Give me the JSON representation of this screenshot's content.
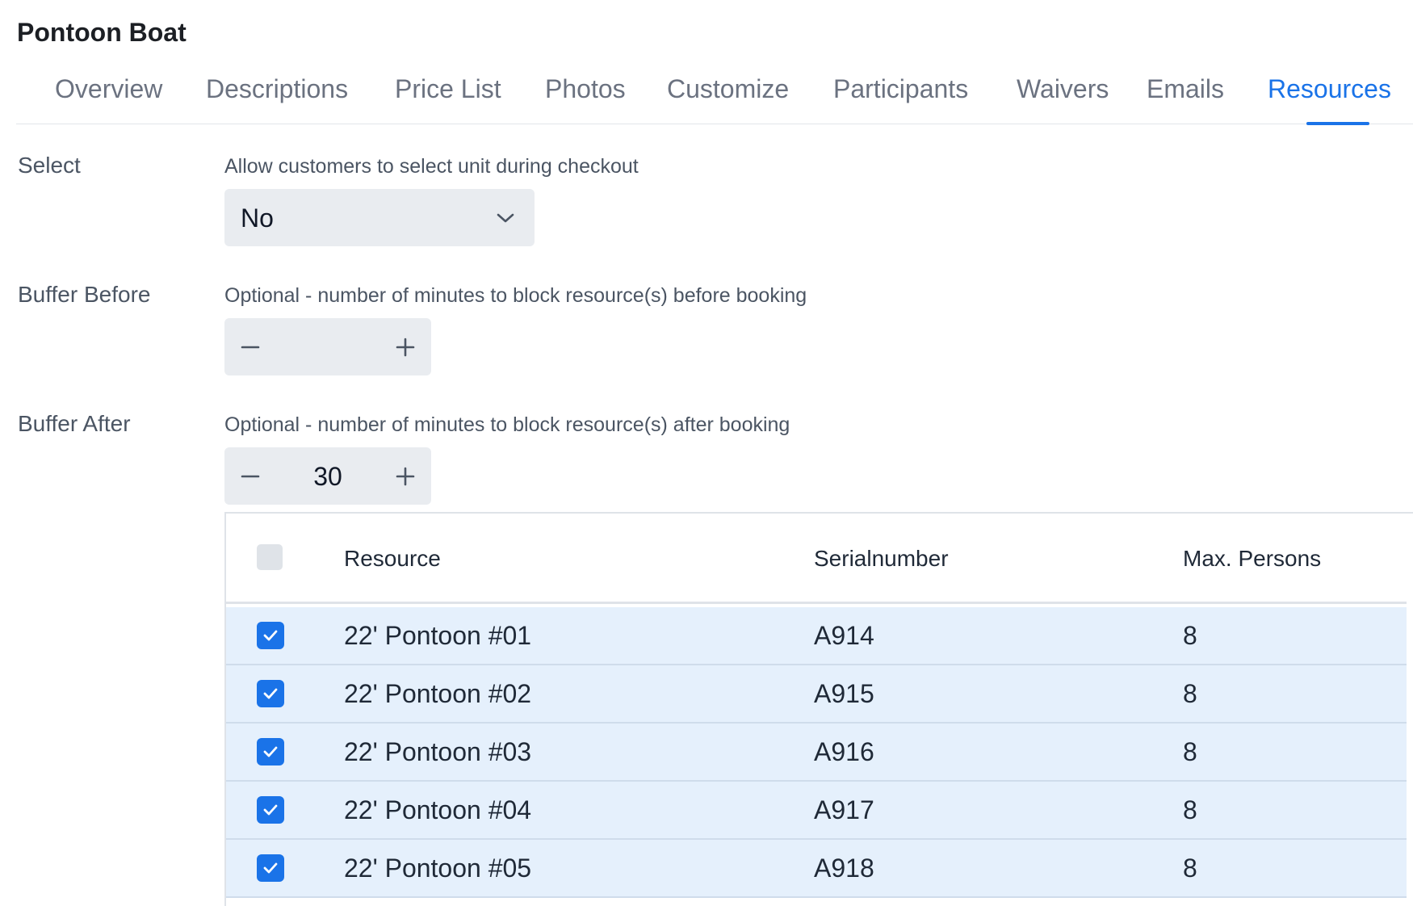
{
  "page": {
    "title": "Pontoon Boat"
  },
  "tabs": [
    {
      "label": "Overview",
      "active": false
    },
    {
      "label": "Descriptions",
      "active": false
    },
    {
      "label": "Price List",
      "active": false
    },
    {
      "label": "Photos",
      "active": false
    },
    {
      "label": "Customize",
      "active": false
    },
    {
      "label": "Participants",
      "active": false
    },
    {
      "label": "Waivers",
      "active": false
    },
    {
      "label": "Emails",
      "active": false
    },
    {
      "label": "Resources",
      "active": true
    }
  ],
  "settings": {
    "select": {
      "label": "Select",
      "help": "Allow customers to select unit during checkout",
      "value": "No"
    },
    "buffer_before": {
      "label": "Buffer Before",
      "help": "Optional - number of minutes to block resource(s) before booking",
      "value": ""
    },
    "buffer_after": {
      "label": "Buffer After",
      "help": "Optional - number of minutes to block resource(s) after booking",
      "value": "30"
    }
  },
  "table": {
    "header": {
      "resource": "Resource",
      "serial": "Serialnumber",
      "max": "Max. Persons",
      "select_all_checked": false
    },
    "rows": [
      {
        "resource": "22' Pontoon #01",
        "serial": "A914",
        "max": "8",
        "checked": true
      },
      {
        "resource": "22' Pontoon #02",
        "serial": "A915",
        "max": "8",
        "checked": true
      },
      {
        "resource": "22' Pontoon #03",
        "serial": "A916",
        "max": "8",
        "checked": true
      },
      {
        "resource": "22' Pontoon #04",
        "serial": "A917",
        "max": "8",
        "checked": true
      },
      {
        "resource": "22' Pontoon #05",
        "serial": "A918",
        "max": "8",
        "checked": true
      }
    ]
  },
  "colors": {
    "accent": "#1a73e8",
    "row_selected_bg": "#e5f0fc",
    "control_bg": "#e9ecf0"
  },
  "icons": {
    "select_arrow": "chevron-down-icon",
    "decrement": "minus-icon",
    "increment": "plus-icon",
    "checked": "checkmark-icon"
  }
}
